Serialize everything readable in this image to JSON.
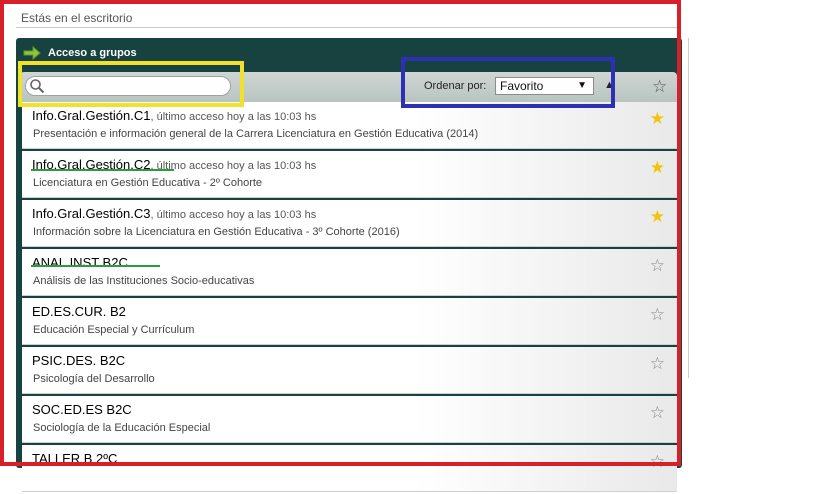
{
  "breadcrumb": "Estás en el escritorio",
  "panel": {
    "title": "Acceso a grupos"
  },
  "search": {
    "value": "",
    "placeholder": ""
  },
  "sort": {
    "label": "Ordenar por:",
    "selected": "Favorito",
    "direction_icon": "sort-up-icon"
  },
  "courses": [
    {
      "code": "Info.Gral.Gestión.C1",
      "access": ", último acceso hoy a las 10:03 hs",
      "description": "Presentación e información general de la Carrera Licenciatura en Gestión Educativa (2014)",
      "favorite": true
    },
    {
      "code": "Info.Gral.Gestión.C2",
      "access": ", último acceso hoy a las 10:03 hs",
      "description": "Licenciatura en Gestión Educativa - 2º Cohorte",
      "favorite": true
    },
    {
      "code": "Info.Gral.Gestión.C3",
      "access": ", último acceso hoy a las 10:03 hs",
      "description": "Información sobre la Licenciatura en Gestión Educativa - 3º Cohorte (2016)",
      "favorite": true
    },
    {
      "code": "ANAL.INST B2C",
      "access": "",
      "description": "Análisis de las Instituciones Socio-educativas",
      "favorite": false
    },
    {
      "code": "ED.ES.CUR. B2",
      "access": "",
      "description": "Educación Especial y Currículum",
      "favorite": false
    },
    {
      "code": "PSIC.DES. B2C",
      "access": "",
      "description": "Psicología del Desarrollo",
      "favorite": false
    },
    {
      "code": "SOC.ED.ES B2C",
      "access": "",
      "description": "Sociología de la Educación Especial",
      "favorite": false
    },
    {
      "code": "TALLER B 2ºC",
      "access": "",
      "description": "",
      "favorite": false
    }
  ],
  "colors": {
    "panel": "#17423f",
    "star_on": "#f2c40d",
    "star_off": "#8a8a8a",
    "red_annotation": "#d8202a",
    "yellow_annotation": "#f1e12a",
    "blue_annotation": "#2d2fb5",
    "green_annotation": "#2e9a3b"
  }
}
